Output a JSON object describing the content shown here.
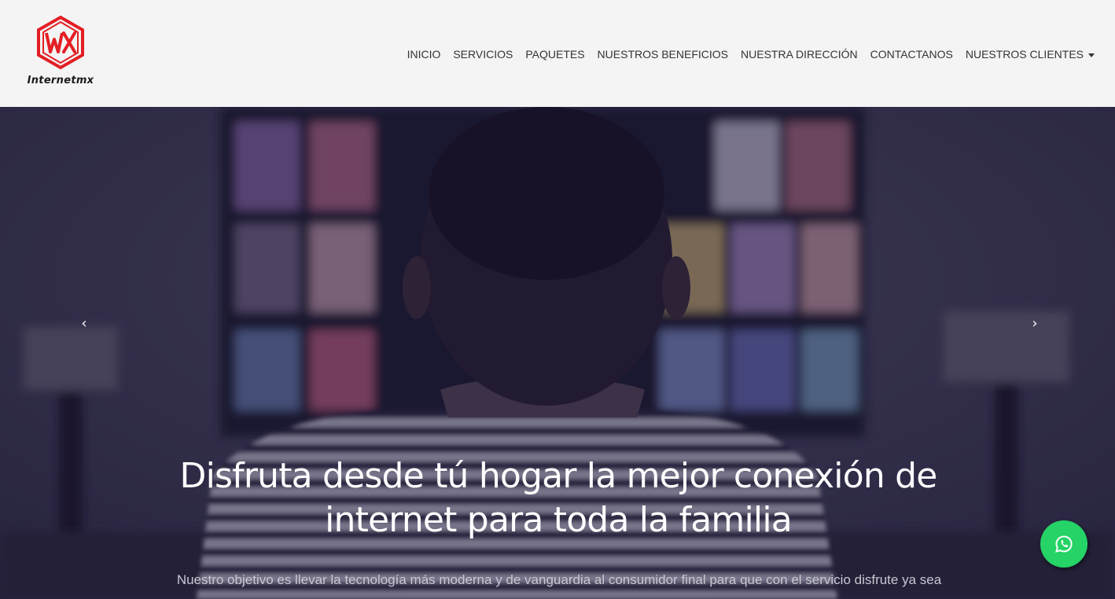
{
  "brand": {
    "name": "Internetmx",
    "logo_icon": "wx-hexagon-logo",
    "logo_color": "#e31e24"
  },
  "nav": {
    "items": [
      {
        "label": "INICIO"
      },
      {
        "label": "SERVICIOS"
      },
      {
        "label": "PAQUETES"
      },
      {
        "label": "NUESTROS BENEFICIOS"
      },
      {
        "label": "NUESTRA DIRECCIÓN"
      },
      {
        "label": "CONTACTANOS"
      },
      {
        "label": "NUESTROS CLIENTES"
      }
    ]
  },
  "hero": {
    "title": "Disfruta desde tú hogar la mejor conexión de internet para toda la familia",
    "subtitle": "Nuestro objetivo es llevar la tecnología más moderna y de vanguardia al consumidor final para que con el servicio disfrute ya sea",
    "prev_icon": "chevron-left-icon",
    "next_icon": "chevron-right-icon",
    "prev_glyph": "‹",
    "next_glyph": "›"
  },
  "whatsapp": {
    "icon": "whatsapp-icon",
    "color": "#25d366"
  }
}
